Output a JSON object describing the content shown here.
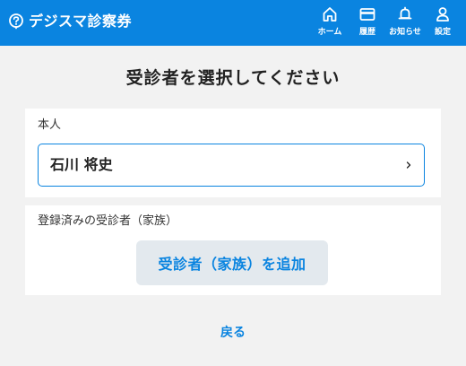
{
  "header": {
    "app_name": "デジスマ診察券",
    "logo_icon": "pin-question-icon",
    "background_color": "#0a84e0",
    "nav": [
      {
        "icon": "home-icon",
        "label": "ホーム"
      },
      {
        "icon": "card-icon",
        "label": "履歴"
      },
      {
        "icon": "bell-icon",
        "label": "お知らせ"
      },
      {
        "icon": "user-icon",
        "label": "設定"
      }
    ]
  },
  "main": {
    "title": "受診者を選択してください",
    "self_section": {
      "label": "本人",
      "patient_name": "石川 将史",
      "chevron_icon": "chevron-right-icon"
    },
    "family_section": {
      "label": "登録済みの受診者（家族）",
      "add_button_label": "受診者（家族）を追加"
    },
    "back_label": "戻る"
  },
  "colors": {
    "accent": "#0a84e0",
    "page_background": "#f2f2f2",
    "card_background": "#ffffff",
    "button_background": "#e3e9ee"
  }
}
